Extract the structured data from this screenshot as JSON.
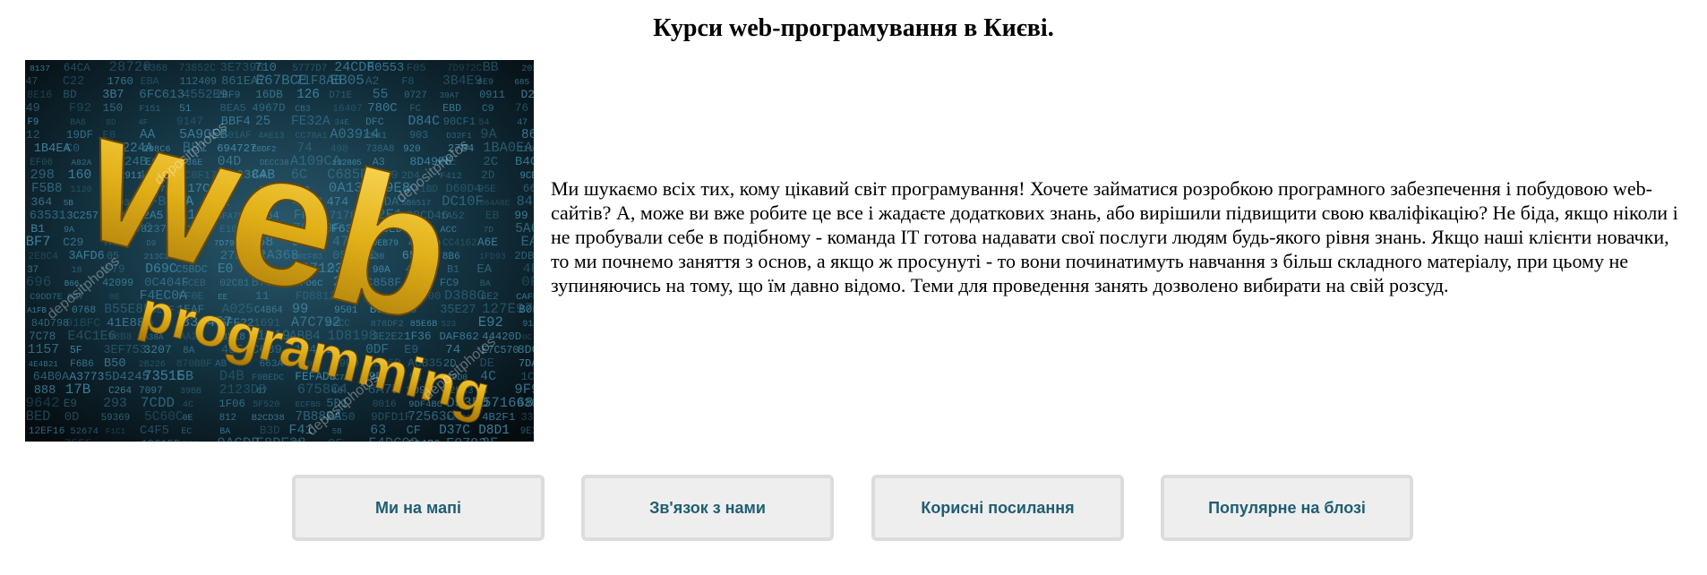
{
  "page": {
    "title": "Курси web-програмування в Києві."
  },
  "hero": {
    "image_name": "web-programming-image",
    "word_web": "web",
    "word_programming": "programming",
    "watermark": "depositphotos",
    "colors": {
      "background": "#0b1a22",
      "code_text": "#3d8fb3",
      "gold": "#e6b81e"
    }
  },
  "intro": {
    "text": "Ми шукаємо всіх тих, кому цікавий світ програмування! Хочете займатися розробкою програмного забезпечення і побудовою web-сайтів? А, може ви вже робите це все і жадаєте додаткових знань, або вирішили підвищити свою кваліфікацію? Не біда, якщо ніколи і не пробували себе в подібному - команда IT готова надавати свої послуги людям будь-якого рівня знань. Якщо наші клієнти новачки, то ми почнемо заняття з основ, а якщо ж просунуті - то вони починатимуть навчання з більш складного матеріалу, при цьому не зупиняючись на тому, що їм давно відомо. Теми для проведення занять дозволено вибирати на свій розсуд."
  },
  "nav": {
    "items": [
      {
        "label": "Ми на мапі"
      },
      {
        "label": "Зв'язок з нами"
      },
      {
        "label": "Корисні посилання"
      },
      {
        "label": "Популярне на блозі"
      }
    ],
    "colors": {
      "button_bg": "#eeeeee",
      "button_border": "#dcdcdc",
      "button_text": "#1f5e73"
    }
  }
}
